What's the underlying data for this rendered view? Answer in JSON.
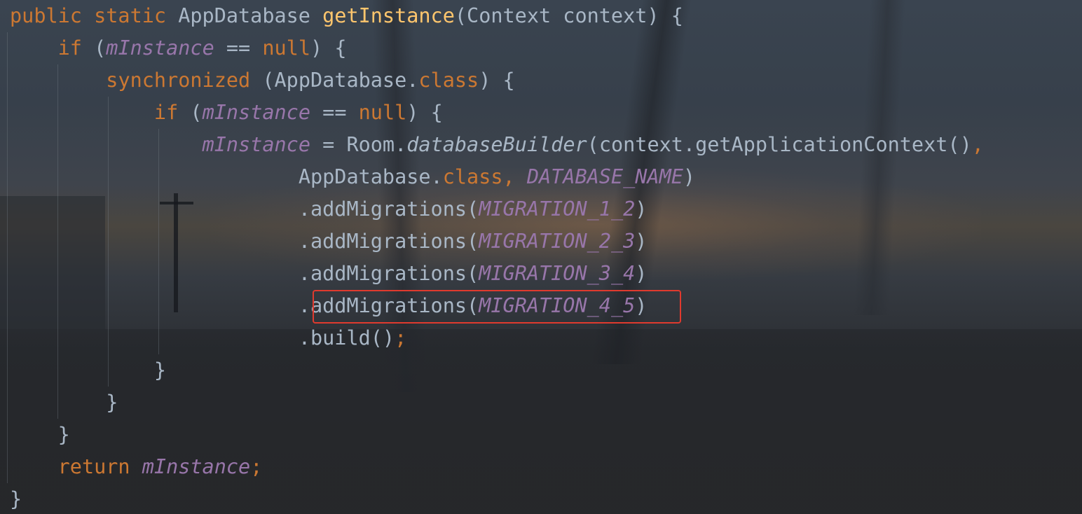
{
  "editor": {
    "lines": [
      {
        "tokens": [
          {
            "text": "public static ",
            "kind": "keyword"
          },
          {
            "text": "AppDatabase ",
            "kind": "plain"
          },
          {
            "text": "getInstance",
            "kind": "method-decl"
          },
          {
            "text": "(Context context) {",
            "kind": "plain"
          }
        ]
      },
      {
        "tokens": [
          {
            "text": "    ",
            "kind": "plain"
          },
          {
            "text": "if ",
            "kind": "keyword"
          },
          {
            "text": "(",
            "kind": "plain"
          },
          {
            "text": "mInstance",
            "kind": "field"
          },
          {
            "text": " == ",
            "kind": "plain"
          },
          {
            "text": "null",
            "kind": "keyword"
          },
          {
            "text": ") {",
            "kind": "plain"
          }
        ]
      },
      {
        "tokens": [
          {
            "text": "        ",
            "kind": "plain"
          },
          {
            "text": "synchronized ",
            "kind": "keyword"
          },
          {
            "text": "(AppDatabase.",
            "kind": "plain"
          },
          {
            "text": "class",
            "kind": "keyword"
          },
          {
            "text": ") {",
            "kind": "plain"
          }
        ]
      },
      {
        "tokens": [
          {
            "text": "            ",
            "kind": "plain"
          },
          {
            "text": "if ",
            "kind": "keyword"
          },
          {
            "text": "(",
            "kind": "plain"
          },
          {
            "text": "mInstance",
            "kind": "field"
          },
          {
            "text": " == ",
            "kind": "plain"
          },
          {
            "text": "null",
            "kind": "keyword"
          },
          {
            "text": ") {",
            "kind": "plain"
          }
        ]
      },
      {
        "tokens": [
          {
            "text": "                ",
            "kind": "plain"
          },
          {
            "text": "mInstance",
            "kind": "field"
          },
          {
            "text": " = Room.",
            "kind": "plain"
          },
          {
            "text": "databaseBuilder",
            "kind": "static-method"
          },
          {
            "text": "(context.getApplicationContext()",
            "kind": "plain"
          },
          {
            "text": ",",
            "kind": "keyword"
          }
        ]
      },
      {
        "tokens": [
          {
            "text": "                        ",
            "kind": "plain"
          },
          {
            "text": "AppDatabase.",
            "kind": "plain"
          },
          {
            "text": "class, ",
            "kind": "keyword"
          },
          {
            "text": "DATABASE_NAME",
            "kind": "static-field"
          },
          {
            "text": ")",
            "kind": "plain"
          }
        ]
      },
      {
        "tokens": [
          {
            "text": "                        ",
            "kind": "plain"
          },
          {
            "text": ".addMigrations(",
            "kind": "plain"
          },
          {
            "text": "MIGRATION_1_2",
            "kind": "static-field"
          },
          {
            "text": ")",
            "kind": "plain"
          }
        ]
      },
      {
        "tokens": [
          {
            "text": "                        ",
            "kind": "plain"
          },
          {
            "text": ".addMigrations(",
            "kind": "plain"
          },
          {
            "text": "MIGRATION_2_3",
            "kind": "static-field"
          },
          {
            "text": ")",
            "kind": "plain"
          }
        ]
      },
      {
        "tokens": [
          {
            "text": "                        ",
            "kind": "plain"
          },
          {
            "text": ".addMigrations(",
            "kind": "plain"
          },
          {
            "text": "MIGRATION_3_4",
            "kind": "static-field"
          },
          {
            "text": ")",
            "kind": "plain"
          }
        ]
      },
      {
        "tokens": [
          {
            "text": "                        ",
            "kind": "plain"
          },
          {
            "text": ".addMigrations(",
            "kind": "plain"
          },
          {
            "text": "MIGRATION_4_5",
            "kind": "static-field"
          },
          {
            "text": ")",
            "kind": "plain"
          }
        ],
        "highlighted": true
      },
      {
        "tokens": [
          {
            "text": "                        ",
            "kind": "plain"
          },
          {
            "text": ".build()",
            "kind": "plain"
          },
          {
            "text": ";",
            "kind": "keyword"
          }
        ]
      },
      {
        "tokens": [
          {
            "text": "            }",
            "kind": "plain"
          }
        ]
      },
      {
        "tokens": [
          {
            "text": "        }",
            "kind": "plain"
          }
        ]
      },
      {
        "tokens": [
          {
            "text": "    }",
            "kind": "plain"
          }
        ]
      },
      {
        "tokens": [
          {
            "text": "    ",
            "kind": "plain"
          },
          {
            "text": "return ",
            "kind": "keyword"
          },
          {
            "text": "mInstance",
            "kind": "field"
          },
          {
            "text": ";",
            "kind": "keyword"
          }
        ]
      },
      {
        "tokens": [
          {
            "text": "}",
            "kind": "plain"
          }
        ]
      }
    ],
    "colors": {
      "keyword": "#cc7832",
      "method-decl": "#ffc66d",
      "field": "#9876aa",
      "static-field": "#9876aa",
      "plain": "#a9b7c6",
      "highlight-border": "#e03a2e"
    }
  }
}
